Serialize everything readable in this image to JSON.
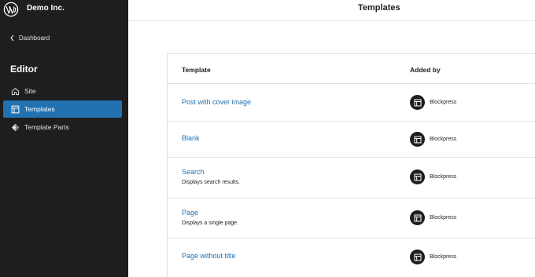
{
  "site": {
    "name": "Demo Inc."
  },
  "sidebar": {
    "back_label": "Dashboard",
    "section_title": "Editor",
    "items": [
      {
        "label": "Site",
        "icon": "home-icon",
        "active": false
      },
      {
        "label": "Templates",
        "icon": "layout-icon",
        "active": true
      },
      {
        "label": "Template Parts",
        "icon": "symbol-filled-icon",
        "active": false
      }
    ]
  },
  "header": {
    "title": "Templates"
  },
  "table": {
    "columns": {
      "template": "Template",
      "added_by": "Added by"
    },
    "rows": [
      {
        "title": "Post with cover image",
        "description": "",
        "author": "Blockpress"
      },
      {
        "title": "Blank",
        "description": "",
        "author": "Blockpress"
      },
      {
        "title": "Search",
        "description": "Displays search results.",
        "author": "Blockpress"
      },
      {
        "title": "Page",
        "description": "Displays a single page.",
        "author": "Blockpress"
      },
      {
        "title": "Page without title",
        "description": "",
        "author": "Blockpress"
      }
    ]
  },
  "colors": {
    "sidebar_bg": "#1e1e1e",
    "accent": "#2271b1",
    "text": "#1e1e1e"
  }
}
